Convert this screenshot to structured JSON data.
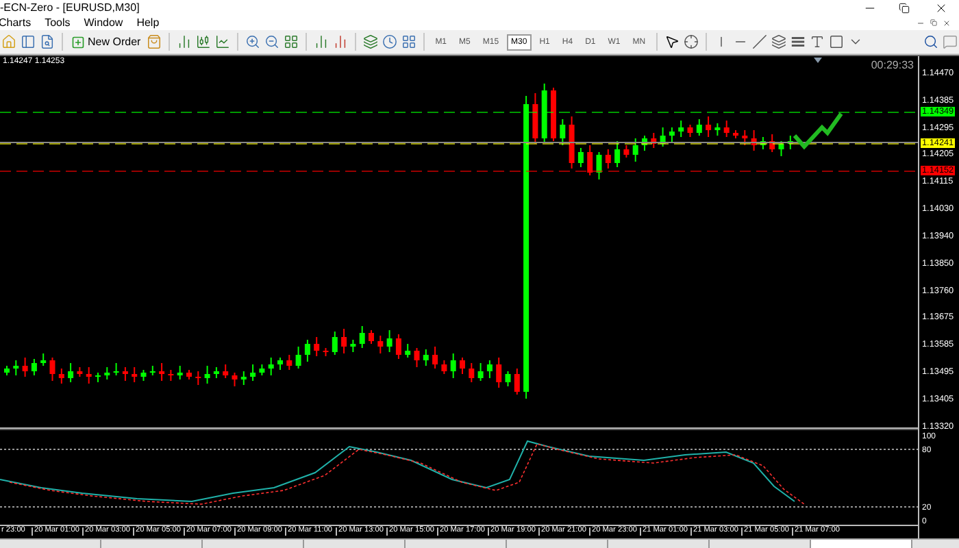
{
  "window": {
    "title": "-ECN-Zero - [EURUSD,M30]"
  },
  "menu": [
    "Charts",
    "Tools",
    "Window",
    "Help"
  ],
  "toolbar": {
    "new_order": "New Order",
    "timeframes": [
      {
        "label": "M1",
        "selected": false
      },
      {
        "label": "M5",
        "selected": false
      },
      {
        "label": "M15",
        "selected": false
      },
      {
        "label": "M30",
        "selected": true
      },
      {
        "label": "H1",
        "selected": false
      },
      {
        "label": "H4",
        "selected": false
      },
      {
        "label": "D1",
        "selected": false
      },
      {
        "label": "W1",
        "selected": false
      },
      {
        "label": "MN",
        "selected": false
      }
    ]
  },
  "chart": {
    "bid_ask": "1.14247 1.14253",
    "timer": "00:29:33",
    "price_axis": [
      "1.14470",
      "1.14385",
      "1.14295",
      "1.14205",
      "1.14115",
      "1.14030",
      "1.13940",
      "1.13850",
      "1.13760",
      "1.13675",
      "1.13585",
      "1.13495",
      "1.13405",
      "1.13320"
    ],
    "price_markers": [
      {
        "price": "1.14349",
        "color": "#00ff00"
      },
      {
        "price": "1.14241",
        "color": "#ffff00"
      },
      {
        "price": "1.14152",
        "color": "#ff0000"
      }
    ],
    "indicator_axis": [
      "100",
      "80",
      "20",
      "0"
    ],
    "time_axis": [
      "r 23:00",
      "20 Mar 01:00",
      "20 Mar 03:00",
      "20 Mar 05:00",
      "20 Mar 07:00",
      "20 Mar 09:00",
      "20 Mar 11:00",
      "20 Mar 13:00",
      "20 Mar 15:00",
      "20 Mar 17:00",
      "20 Mar 19:00",
      "20 Mar 21:00",
      "20 Mar 23:00",
      "21 Mar 01:00",
      "21 Mar 03:00",
      "21 Mar 05:00",
      "21 Mar 07:00"
    ]
  },
  "chart_tabs": [
    {
      "selected": false
    },
    {
      "selected": false
    },
    {
      "selected": false
    },
    {
      "selected": false
    },
    {
      "selected": false
    },
    {
      "selected": false
    },
    {
      "selected": false
    },
    {
      "selected": false
    },
    {
      "selected": true
    }
  ]
}
